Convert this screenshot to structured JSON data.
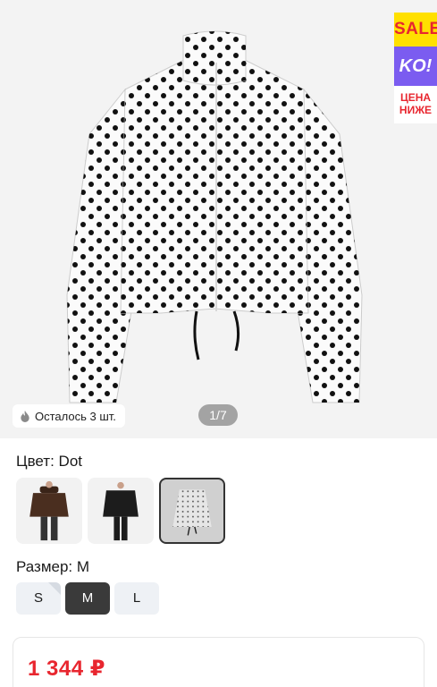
{
  "promo": {
    "sale": "SALE",
    "ko": "KO!",
    "price_line1": "ЦЕНА",
    "price_line2": "НИЖЕ"
  },
  "gallery": {
    "stock_text": "Осталось 3 шт.",
    "pager": "1/7"
  },
  "color": {
    "label": "Цвет: Dot",
    "options": [
      "brown-jacket",
      "black-jacket",
      "dot-jacket"
    ],
    "selected_index": 2
  },
  "size": {
    "label": "Размер: M",
    "options": [
      "S",
      "M",
      "L"
    ],
    "selected": "M"
  },
  "price": {
    "value": "1 344 ₽"
  },
  "colors": {
    "accent_red": "#e8262f",
    "promo_yellow": "#ffe000",
    "promo_purple": "#7b5cf0"
  }
}
